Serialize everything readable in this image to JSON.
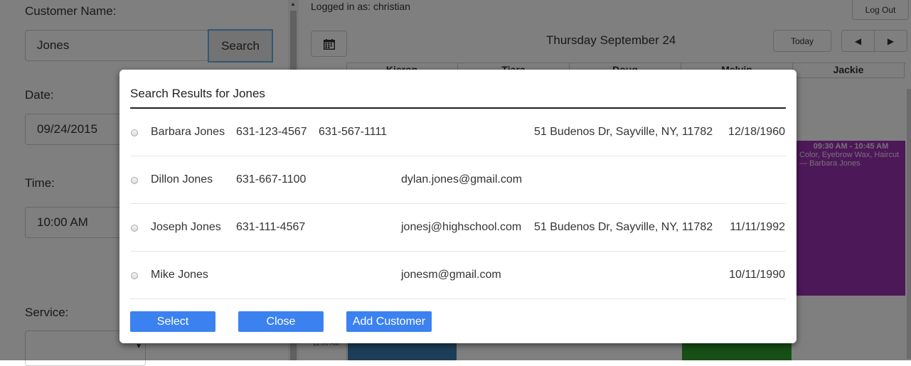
{
  "form": {
    "customer_name_label": "Customer Name:",
    "customer_name_value": "Jones",
    "search_label": "Search",
    "date_label": "Date:",
    "date_value": "09/24/2015",
    "time_label": "Time:",
    "time_value": "10:00 AM",
    "service_label": "Service:",
    "service_value": ""
  },
  "calendar": {
    "logged_in": "Logged in as: christian",
    "logout_label": "Log Out",
    "date_title": "Thursday September 24",
    "today_label": "Today",
    "prev_label": "◀",
    "next_label": "▶",
    "staff": [
      "Kieron",
      "Tiara",
      "Doug",
      "Melvin",
      "Jackie"
    ],
    "time_slot_label": "11:00 AM",
    "appointment": {
      "time": "09:30 AM - 10:45 AM",
      "desc": "Color, Eyebrow Wax, Haircut — Barbara Jones",
      "color": "#9b30b0"
    }
  },
  "modal": {
    "title": "Search Results for Jones",
    "results": [
      {
        "name": "Barbara Jones",
        "phone1": "631-123-4567",
        "phone2": "631-567-1111",
        "email": "",
        "address": "51 Budenos Dr, Sayville, NY, 11782",
        "dob": "12/18/1960"
      },
      {
        "name": "Dillon Jones",
        "phone1": "631-667-1100",
        "phone2": "",
        "email": "dylan.jones@gmail.com",
        "address": "",
        "dob": ""
      },
      {
        "name": "Joseph Jones",
        "phone1": "631-111-4567",
        "phone2": "",
        "email": "jonesj@highschool.com",
        "address": "51 Budenos Dr, Sayville, NY, 11782",
        "dob": "11/11/1992"
      },
      {
        "name": "Mike Jones",
        "phone1": "",
        "phone2": "",
        "email": "jonesm@gmail.com",
        "address": "",
        "dob": "10/11/1990"
      }
    ],
    "select_label": "Select",
    "close_label": "Close",
    "add_customer_label": "Add Customer",
    "button_color": "#3b82f0"
  }
}
